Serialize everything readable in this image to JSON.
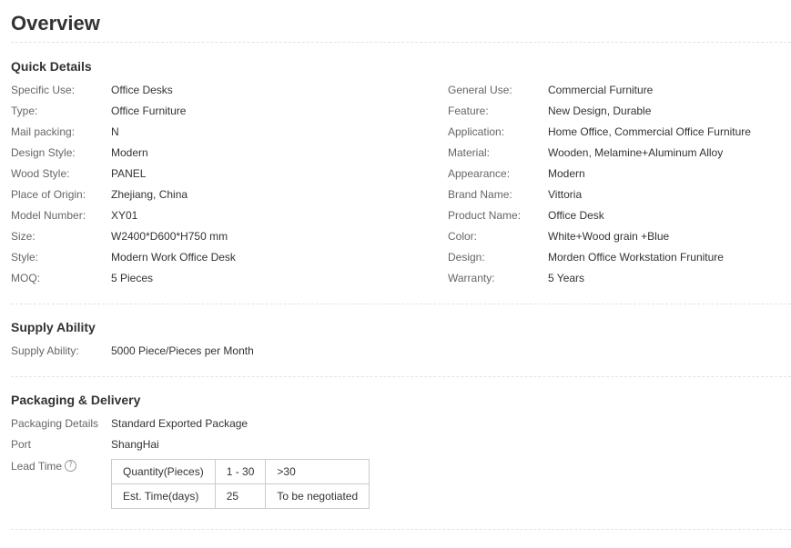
{
  "overview_title": "Overview",
  "quick_details": {
    "title": "Quick Details",
    "left": [
      {
        "label": "Specific Use:",
        "value": "Office Desks"
      },
      {
        "label": "Type:",
        "value": "Office Furniture"
      },
      {
        "label": "Mail packing:",
        "value": "N"
      },
      {
        "label": "Design Style:",
        "value": "Modern"
      },
      {
        "label": "Wood Style:",
        "value": "PANEL"
      },
      {
        "label": "Place of Origin:",
        "value": "Zhejiang, China"
      },
      {
        "label": "Model Number:",
        "value": "XY01"
      },
      {
        "label": "Size:",
        "value": "W2400*D600*H750 mm"
      },
      {
        "label": "Style:",
        "value": "Modern Work Office Desk"
      },
      {
        "label": "MOQ:",
        "value": "5 Pieces"
      }
    ],
    "right": [
      {
        "label": "General Use:",
        "value": "Commercial Furniture"
      },
      {
        "label": "Feature:",
        "value": "New Design, Durable"
      },
      {
        "label": "Application:",
        "value": "Home Office, Commercial Office Furniture"
      },
      {
        "label": "Material:",
        "value": "Wooden, Melamine+Aluminum Alloy"
      },
      {
        "label": "Appearance:",
        "value": "Modern"
      },
      {
        "label": "Brand Name:",
        "value": "Vittoria"
      },
      {
        "label": "Product Name:",
        "value": "Office Desk"
      },
      {
        "label": "Color:",
        "value": "White+Wood grain +Blue"
      },
      {
        "label": "Design:",
        "value": "Morden Office Workstation Fruniture"
      },
      {
        "label": "Warranty:",
        "value": "5 Years"
      }
    ]
  },
  "supply_ability": {
    "title": "Supply Ability",
    "label": "Supply Ability:",
    "value": "5000 Piece/Pieces per Month"
  },
  "packaging": {
    "title": "Packaging & Delivery",
    "details_label": "Packaging Details",
    "details_value": "Standard Exported Package",
    "port_label": "Port",
    "port_value": "ShangHai",
    "lead_time_label": "Lead Time",
    "help_icon_glyph": "?",
    "lead_table": [
      [
        "Quantity(Pieces)",
        "1 - 30",
        ">30"
      ],
      [
        "Est. Time(days)",
        "25",
        "To be negotiated"
      ]
    ]
  }
}
